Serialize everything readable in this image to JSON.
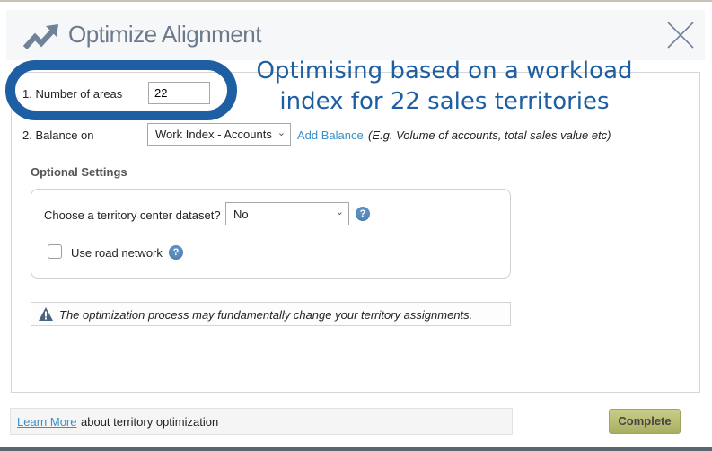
{
  "dialog": {
    "title": "Optimize Alignment",
    "title_icon": "trending-up-icon",
    "close_icon": "close-icon"
  },
  "form": {
    "number_of_areas": {
      "label": "1. Number of areas",
      "value": "22"
    },
    "balance_on": {
      "label": "2. Balance on",
      "selected": "Work Index - Accounts",
      "add_balance_link": "Add Balance",
      "hint": "(E.g. Volume of accounts, total sales value etc)"
    }
  },
  "optional_settings": {
    "title": "Optional Settings",
    "center_dataset": {
      "label": "Choose a territory center dataset?",
      "selected": "No"
    },
    "road_network": {
      "label": "Use road network",
      "checked": false
    },
    "help_glyph": "?"
  },
  "warning": {
    "icon": "warning-icon",
    "text": "The optimization process may fundamentally change your territory assignments."
  },
  "footer": {
    "learn_more_link": "Learn More",
    "learn_more_text": "about territory optimization",
    "complete_button": "Complete"
  },
  "annotation": {
    "line1": "Optimising based on a workload",
    "line2": "index for 22 sales territories",
    "color": "#1d5fa2"
  },
  "colors": {
    "link": "#3a8fc7",
    "complete_button": "#b5ba70",
    "help_icon": "#5b8fc4"
  }
}
